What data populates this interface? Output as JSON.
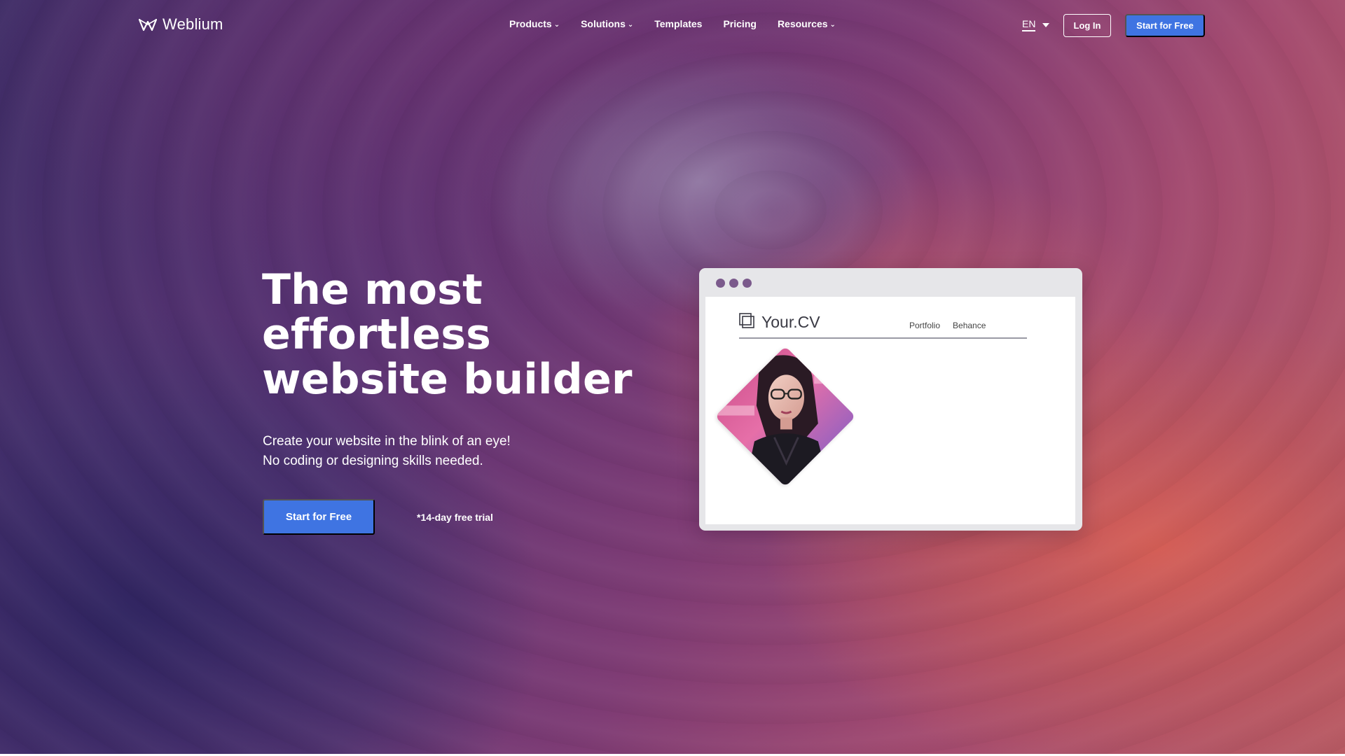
{
  "brand": {
    "name": "Weblium"
  },
  "nav": {
    "items": [
      {
        "label": "Products",
        "dropdown": true
      },
      {
        "label": "Solutions",
        "dropdown": true
      },
      {
        "label": "Templates",
        "dropdown": false
      },
      {
        "label": "Pricing",
        "dropdown": false
      },
      {
        "label": "Resources",
        "dropdown": true
      }
    ],
    "language": "EN",
    "login_label": "Log In",
    "start_label": "Start for Free"
  },
  "hero": {
    "title_lines": [
      "The most",
      "effortless",
      "website builder"
    ],
    "subtitle_lines": [
      "Create your website in the blink of an eye!",
      "No coding or designing skills needed."
    ],
    "cta_label": "Start for Free",
    "trial_note": "*14-day free trial"
  },
  "mockup": {
    "site_name": "Your.CV",
    "links": [
      "Portfolio",
      "Behance"
    ]
  },
  "colors": {
    "accent": "#3f74e2",
    "mock_dot": "#7b5a8c"
  },
  "icons": {
    "logo": "weblium-w-logo-icon",
    "cv_logo": "square-frame-icon",
    "dropdown": "chevron-down-icon",
    "language": "caret-down-icon"
  }
}
